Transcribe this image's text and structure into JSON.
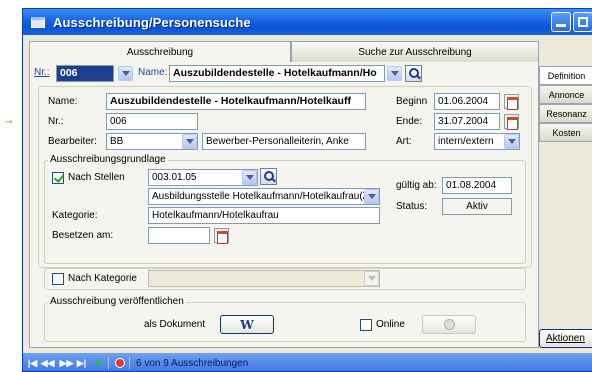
{
  "window": {
    "title": "Ausschreibung/Personensuche"
  },
  "tabs": [
    {
      "label": "Ausschreibung"
    },
    {
      "label": "Suche zur Ausschreibung"
    }
  ],
  "right_tabs": [
    {
      "label": "Definition"
    },
    {
      "label": "Annonce"
    },
    {
      "label": "Resonanz"
    },
    {
      "label": "Kosten"
    }
  ],
  "selector": {
    "nr_label": "Nr.:",
    "nr_value": "006",
    "name_label": "Name:",
    "name_value": "Auszubildendestelle - Hotelkaufmann/Ho"
  },
  "form": {
    "name_label": "Name:",
    "name_value": "Auszubildendestelle - Hotelkaufmann/Hotelkauff",
    "nr_label": "Nr.:",
    "nr_value": "006",
    "bearbeiter_label": "Bearbeiter:",
    "bearbeiter_code": "BB",
    "bearbeiter_name": "Bewerber-Personalleiterin, Anke",
    "beginn_label": "Beginn",
    "beginn_value": "01.06.2004",
    "ende_label": "Ende:",
    "ende_value": "31.07.2004",
    "art_label": "Art:",
    "art_value": "intern/extern"
  },
  "grundlage": {
    "title": "Ausschreibungsgrundlage",
    "nach_stellen_label": "Nach Stellen",
    "stellen_code": "003.01.05",
    "stellen_name": "Ausbildungsstelle Hotelkaufmann/Hotelkaufrau(Z",
    "gueltig_label": "gültig ab:",
    "gueltig_value": "01.08.2004",
    "status_label": "Status:",
    "status_value": "Aktiv",
    "kategorie_label": "Kategorie:",
    "kategorie_value": "Hotelkaufmann/Hotelkaufrau",
    "besetzen_label": "Besetzen am:",
    "besetzen_value": ""
  },
  "nach_kategorie": {
    "label": "Nach Kategorie"
  },
  "publish": {
    "title": "Ausschreibung veröffentlichen",
    "dokument_label": "als Dokument",
    "online_label": "Online"
  },
  "aktionen": {
    "label": "Aktionen"
  },
  "status_bar": {
    "text": "6 von 9 Ausschreibungen"
  }
}
